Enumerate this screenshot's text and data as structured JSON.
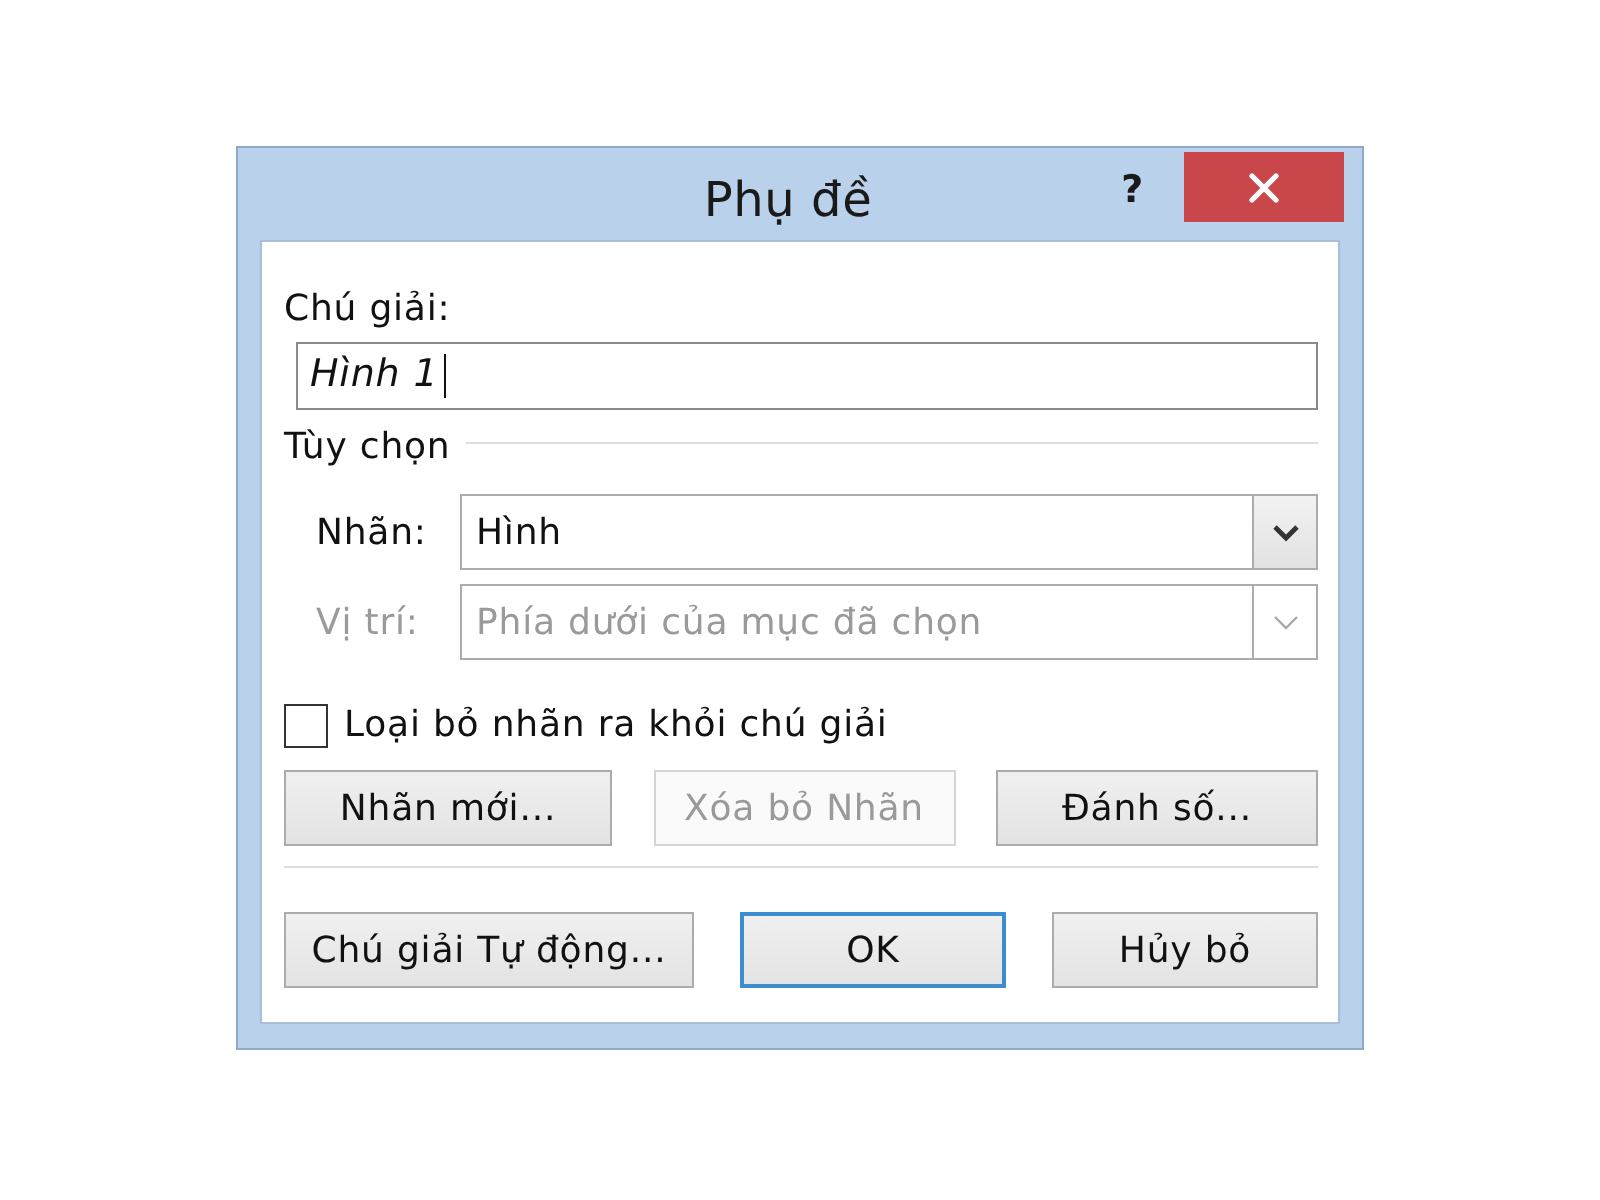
{
  "window": {
    "title": "Phụ đề",
    "help": "?"
  },
  "caption": {
    "label": "Chú giải:",
    "value": "Hình 1",
    "focused": true
  },
  "options": {
    "title": "Tùy chọn",
    "fields": [
      {
        "label": "Nhãn:",
        "value": "Hình",
        "disabled": false
      },
      {
        "label": "Vị trí:",
        "value": "Phía dưới của mục đã chọn",
        "disabled": true
      }
    ]
  },
  "exclude_label": {
    "label": "Loại bỏ nhãn ra khỏi chú giải",
    "checked": false
  },
  "label_buttons": [
    {
      "label": "Nhãn mới...",
      "disabled": false
    },
    {
      "label": "Xóa bỏ Nhãn",
      "disabled": true
    },
    {
      "label": "Đánh số...",
      "disabled": false
    }
  ],
  "footer_buttons": [
    {
      "label": "Chú giải Tự động...",
      "default": false
    },
    {
      "label": "OK",
      "default": true
    },
    {
      "label": "Hủy bỏ",
      "default": false
    }
  ]
}
